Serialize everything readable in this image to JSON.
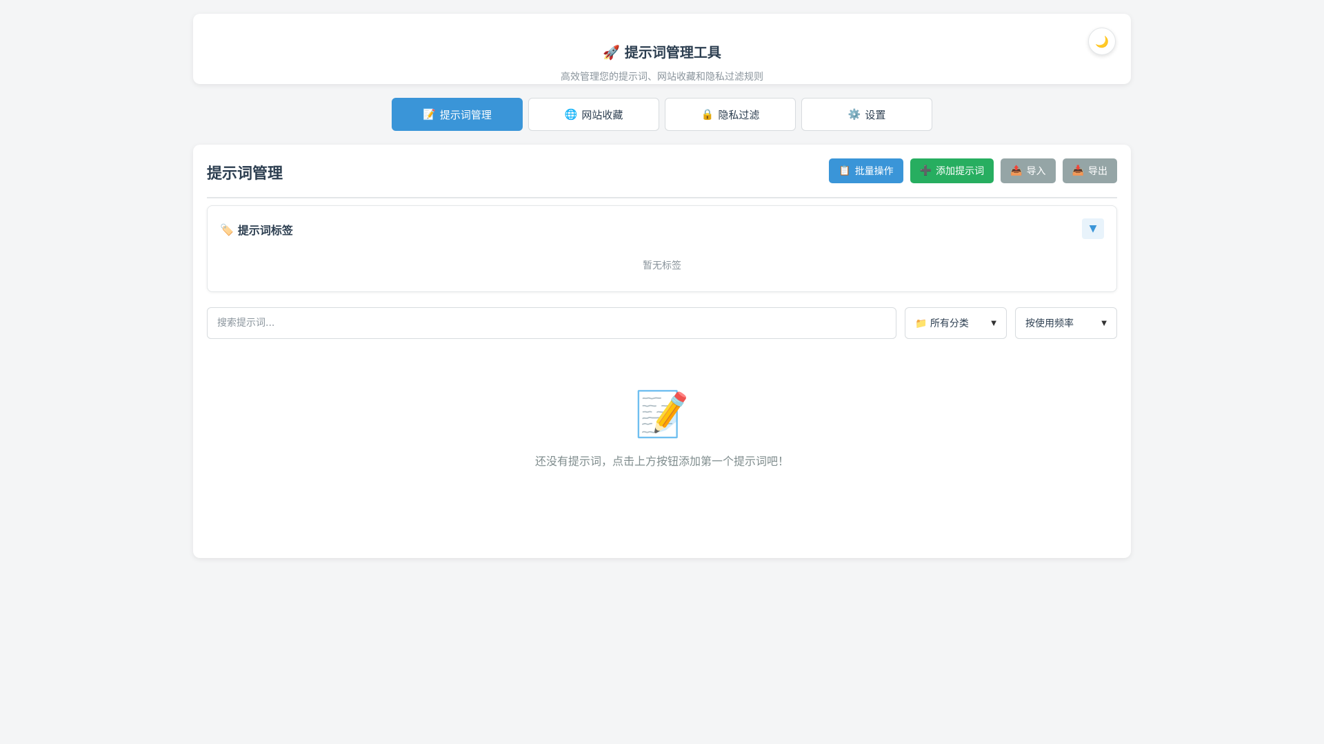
{
  "header": {
    "title": "🚀 提示词管理工具",
    "subtitle": "高效管理您的提示词、网站收藏和隐私过滤规则",
    "theme_icon": "🌙"
  },
  "tabs": [
    {
      "icon": "📝",
      "label": "提示词管理",
      "active": true
    },
    {
      "icon": "🌐",
      "label": "网站收藏",
      "active": false
    },
    {
      "icon": "🔒",
      "label": "隐私过滤",
      "active": false
    },
    {
      "icon": "⚙️",
      "label": "设置",
      "active": false
    }
  ],
  "panel": {
    "title": "提示词管理",
    "actions": [
      {
        "icon": "📋",
        "label": "批量操作",
        "color": "#3a95d8"
      },
      {
        "icon": "➕",
        "label": "添加提示词",
        "color": "#27ae60"
      },
      {
        "icon": "📤",
        "label": "导入",
        "color": "#95a5a6"
      },
      {
        "icon": "📥",
        "label": "导出",
        "color": "#95a5a6"
      }
    ],
    "tags": {
      "icon": "🏷️",
      "title": "提示词标签",
      "collapse_icon": "▼",
      "empty_text": "暂无标签"
    },
    "search": {
      "placeholder": "搜索提示词..."
    },
    "category_select": {
      "icon": "📁",
      "value": "所有分类"
    },
    "sort_select": {
      "value": "按使用频率"
    },
    "empty_state": {
      "icon": "📝",
      "text": "还没有提示词，点击上方按钮添加第一个提示词吧！"
    }
  }
}
